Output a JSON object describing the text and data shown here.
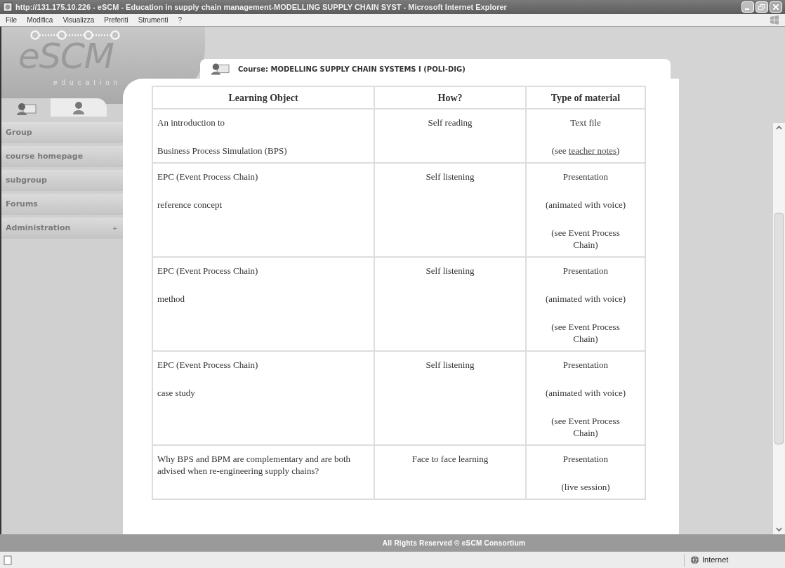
{
  "window": {
    "title": "http://131.175.10.226 - eSCM - Education in supply chain management-MODELLING SUPPLY CHAIN SYST - Microsoft Internet Explorer"
  },
  "menu": [
    "File",
    "Modifica",
    "Visualizza",
    "Preferiti",
    "Strumenti",
    "?"
  ],
  "logo": {
    "name": "eSCM",
    "tagline": "education"
  },
  "sidebar": {
    "items": [
      {
        "label": "Group"
      },
      {
        "label": "course homepage"
      },
      {
        "label": "subgroup"
      },
      {
        "label": "Forums"
      },
      {
        "label": "Administration",
        "expander": "+"
      }
    ]
  },
  "course_title": "Course: MODELLING SUPPLY CHAIN SYSTEMS I (POLI-DIG)",
  "table": {
    "columns": [
      "Learning Object",
      "How?",
      "Type of material"
    ],
    "rows": [
      {
        "cells": [
          [
            {
              "text": "An introduction to"
            },
            {
              "text": "Business Process Simulation (BPS)"
            }
          ],
          [
            {
              "text": "Self reading"
            }
          ],
          [
            {
              "text": "Text file"
            },
            {
              "text": "(see ",
              "link": "teacher notes",
              "after": ")"
            }
          ]
        ]
      },
      {
        "cells": [
          [
            {
              "text": "EPC (Event Process Chain)"
            },
            {
              "text": "reference concept"
            }
          ],
          [
            {
              "text": "Self listening"
            }
          ],
          [
            {
              "text": "Presentation"
            },
            {
              "text": "(animated with voice)"
            },
            {
              "text": "(see Event Process Chain)"
            }
          ]
        ]
      },
      {
        "cells": [
          [
            {
              "text": "EPC (Event Process Chain)"
            },
            {
              "text": "method"
            }
          ],
          [
            {
              "text": "Self listening"
            }
          ],
          [
            {
              "text": "Presentation"
            },
            {
              "text": "(animated with voice)"
            },
            {
              "text": "(see Event Process Chain)"
            }
          ]
        ]
      },
      {
        "cells": [
          [
            {
              "text": "EPC (Event Process Chain)"
            },
            {
              "text": "case study"
            }
          ],
          [
            {
              "text": "Self listening"
            }
          ],
          [
            {
              "text": "Presentation"
            },
            {
              "text": "(animated with voice)"
            },
            {
              "text": "(see Event Process Chain)"
            }
          ]
        ]
      },
      {
        "cells": [
          [
            {
              "text": "Why BPS and BPM are complementary and are both advised when re-engineering supply chains?"
            }
          ],
          [
            {
              "text": "Face to face learning"
            }
          ],
          [
            {
              "text": "Presentation"
            },
            {
              "text": "(live session)"
            }
          ]
        ]
      }
    ]
  },
  "footer": "All Rights Reserved © eSCM Consortium",
  "status_bar": {
    "zone": "Internet"
  }
}
